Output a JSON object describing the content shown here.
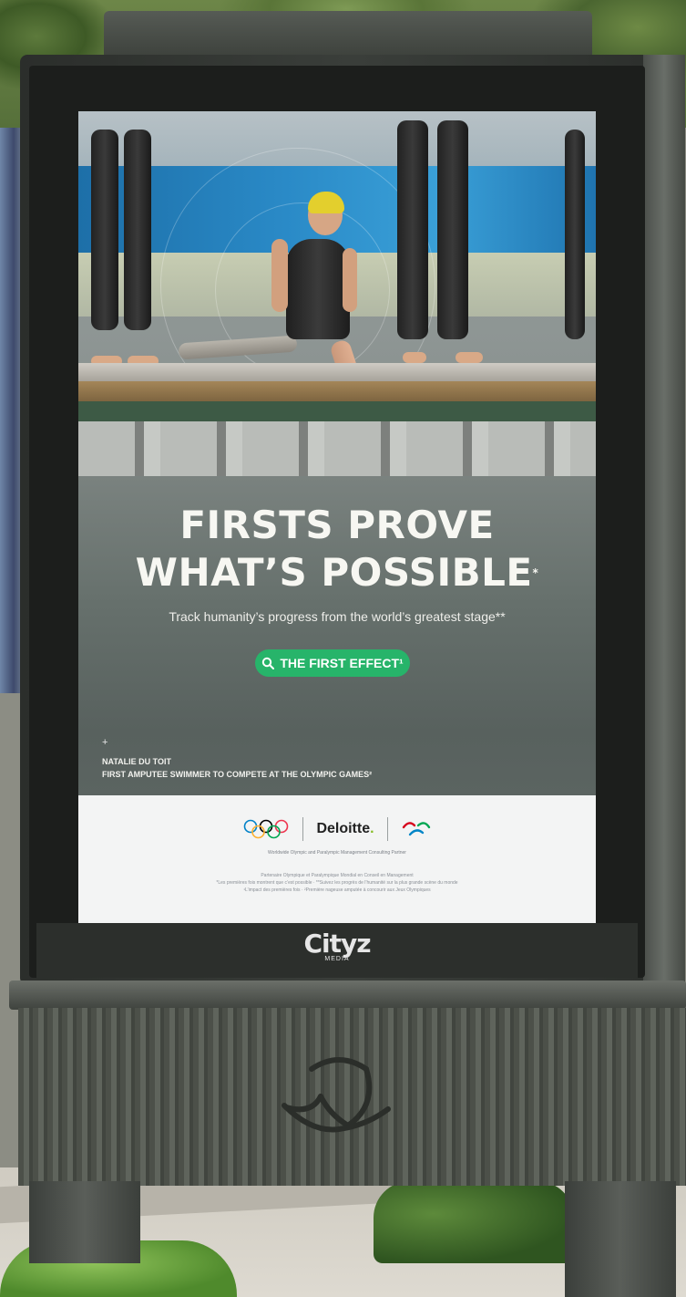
{
  "poster": {
    "headline_line1": "FIRSTS PROVE",
    "headline_line2": "WHAT’S POSSIBLE",
    "headline_mark": "*",
    "tagline": "Track humanity’s progress from the world’s greatest stage**",
    "cta_label": "THE FIRST EFFECT¹",
    "cta_icon": "search-icon",
    "caption_plus": "+",
    "caption_name": "NATALIE DU TOIT",
    "caption_desc": "FIRST AMPUTEE SWIMMER TO COMPETE AT THE OLYMPIC GAMES²",
    "sponsor_name": "Deloitte",
    "sponsor_dot": ".",
    "partner_line": "Worldwide Olympic and Paralympic Management Consulting Partner",
    "fine_print": [
      "Partenaire Olympique et Paralympique Mondial en Conseil en Management",
      "*Les premières fois montrent que c’est possible · **Suivez les progrès de l’humanité sur la plus grande scène du monde",
      "¹L’impact des premières fois · ²Première nageuse amputée à concourir aux Jeux Olympiques"
    ]
  },
  "kiosk": {
    "brand": "ityz",
    "brand_initial": "C",
    "brand_sub": "MEDIA"
  },
  "colors": {
    "cta_green": "#27b46a",
    "deloitte_green": "#86bc25",
    "swim_cap_yellow": "#e3cf2d"
  }
}
